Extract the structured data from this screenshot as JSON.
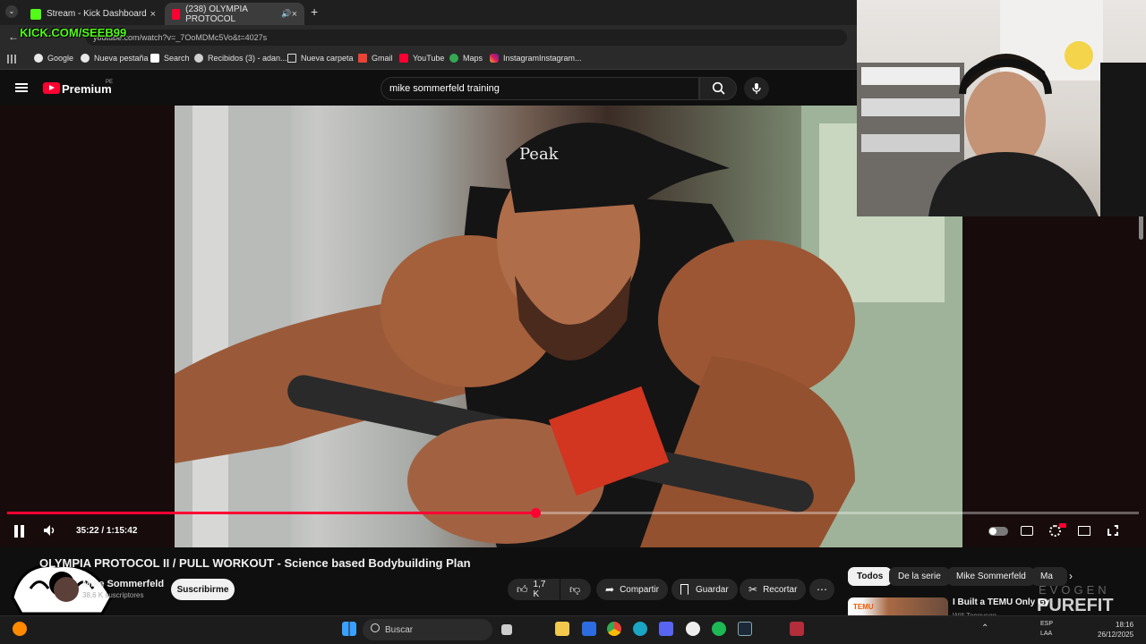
{
  "browser": {
    "tabs": [
      {
        "label": "Stream - Kick Dashboard",
        "close": "×"
      },
      {
        "label": "(238) OLYMPIA PROTOCOL",
        "close": "×"
      }
    ],
    "new_tab": "+",
    "overlay_handle": "KICK.COM/SEEB99",
    "url": "youtube.com/watch?v=_7OoMDMc5Vo&t=4027s",
    "bookmarks": [
      "Google",
      "Nueva pestaña",
      "Search",
      "Recibidos (3) - adan...",
      "Nueva carpeta",
      "Gmail",
      "YouTube",
      "Maps",
      "InstagramInstagram..."
    ]
  },
  "youtube": {
    "logo_text": "Premium",
    "logo_badge": "PE",
    "search_value": "mike sommerfeld training"
  },
  "player": {
    "time": "35:22 / 1:15:42",
    "progress_fraction": 0.467
  },
  "video": {
    "title": "OLYMPIA PROTOCOL II / PULL WORKOUT - Science based Bodybuilding Plan",
    "channel": "Mike Sommerfeld",
    "subscribers": "38,6 K suscriptores",
    "subscribe": "Suscribirme",
    "likes": "1,7 K",
    "share": "Compartir",
    "save": "Guardar",
    "clip": "Recortar"
  },
  "sidebar": {
    "chips": [
      "Todos",
      "De la serie",
      "Mike Sommerfeld",
      "Ma"
    ],
    "rec_title": "I Built a TEMU Only Gy",
    "rec_thumb_label": "TEMU",
    "rec_channel": "Will Tennyson"
  },
  "watermark": {
    "line1": "EVOGEN",
    "line2": "PUREFIT"
  },
  "taskbar": {
    "search": "Buscar",
    "lang": "ESP",
    "lang2": "LAA",
    "clock": "18:16",
    "date": "26/12/2025"
  },
  "colors": {
    "accent": "#ff0033",
    "bg": "#0f0f0f",
    "kick": "#53fc18"
  }
}
